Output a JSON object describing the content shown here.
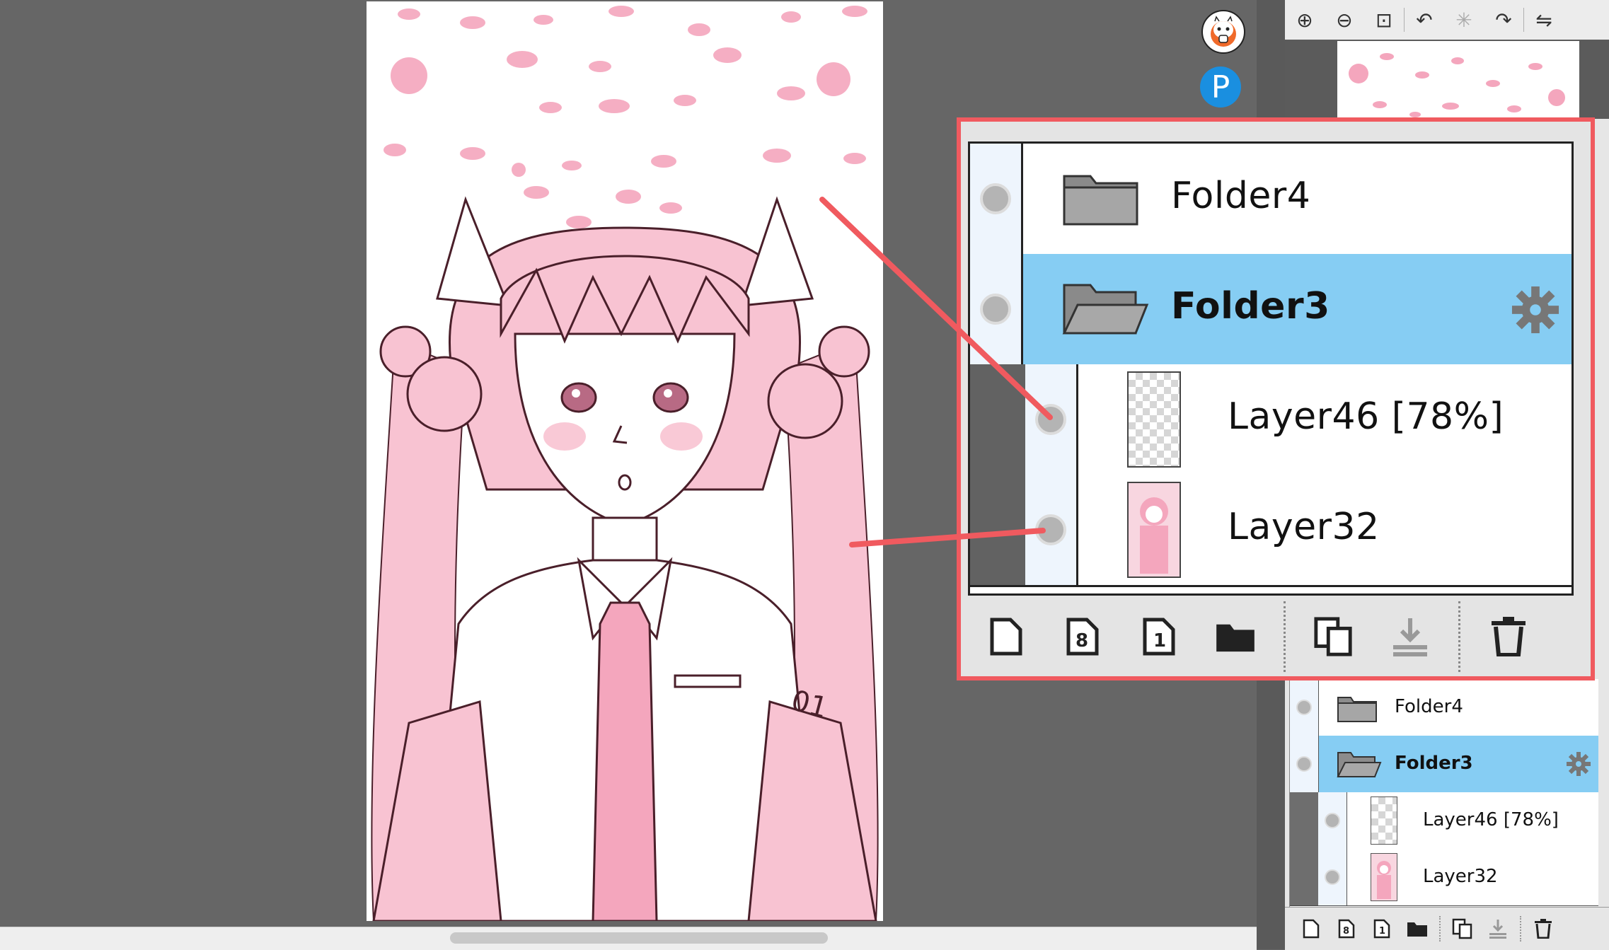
{
  "canvas": {
    "artwork_name": "pink twin-tail character line art",
    "colors": {
      "pink": "#f8c3d2",
      "line": "#4a1f2a",
      "petal": "#f4a6bd"
    }
  },
  "overlay_badges": [
    {
      "icon": "alpaca-avatar-icon"
    },
    {
      "icon": "pixiv-p-icon",
      "glyph": "P"
    }
  ],
  "navigator": {
    "tools": [
      {
        "icon": "zoom-in-icon",
        "glyph": "⊕"
      },
      {
        "icon": "zoom-out-icon",
        "glyph": "⊖"
      },
      {
        "icon": "zoom-fit-icon",
        "glyph": "⊡"
      },
      {
        "icon": "rotate-left-icon",
        "glyph": "↶"
      },
      {
        "icon": "rotate-reset-icon",
        "glyph": "✳"
      },
      {
        "icon": "rotate-right-icon",
        "glyph": "↷"
      },
      {
        "icon": "flip-horizontal-icon",
        "glyph": "⇋"
      }
    ]
  },
  "layers": {
    "items": [
      {
        "name": "Folder4",
        "type": "folder",
        "selected": false
      },
      {
        "name": "Folder3",
        "type": "folder-open",
        "selected": true,
        "settings_icon": "gear-icon"
      },
      {
        "name": "Layer46 [78%]",
        "type": "layer",
        "selected": false,
        "thumbnail": "transparent"
      },
      {
        "name": "Layer32",
        "type": "layer",
        "selected": false,
        "thumbnail": "artwork"
      }
    ],
    "toolbar": [
      {
        "icon": "new-layer-icon"
      },
      {
        "icon": "new-8bit-layer-icon",
        "glyph": "8"
      },
      {
        "icon": "new-1bit-layer-icon",
        "glyph": "1"
      },
      {
        "icon": "new-folder-icon"
      },
      {
        "icon": "duplicate-layer-icon"
      },
      {
        "icon": "merge-down-icon"
      },
      {
        "icon": "delete-layer-icon"
      }
    ]
  },
  "callout": {
    "color": "#f05a5f"
  },
  "selection_color": "#86cdf3"
}
